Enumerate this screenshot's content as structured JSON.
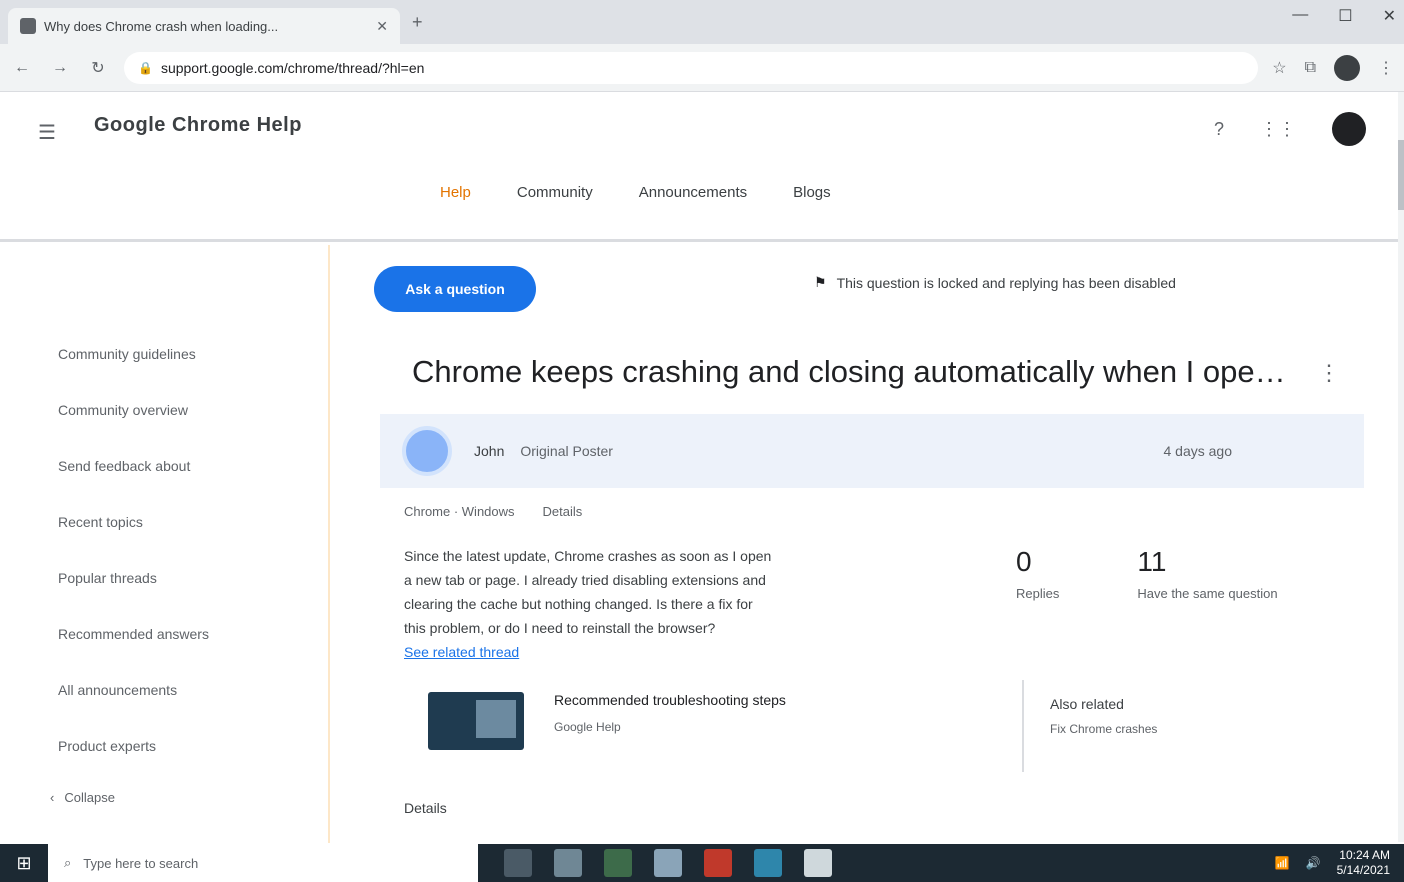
{
  "browser": {
    "tab_title": "Why does Chrome crash when loading...",
    "new_tab_symbol": "+",
    "window_controls": [
      "—",
      "☐",
      "✕"
    ],
    "url": "support.google.com/chrome/thread/?hl=en",
    "nav_symbols": [
      "←",
      "→",
      "↻"
    ],
    "toolbar_icons": [
      "star-icon",
      "extension-icon",
      "more-icon"
    ]
  },
  "site": {
    "logo": "Google Chrome Help",
    "nav_tabs": [
      "Help",
      "Community",
      "Announcements",
      "Blogs"
    ],
    "active_tab": 0,
    "header_icons": [
      "help-icon",
      "apps-icon",
      "account-avatar"
    ]
  },
  "sidebar": {
    "items": [
      "Community guidelines",
      "Community overview",
      "Send feedback about",
      "Recent topics",
      "Popular threads",
      "Recommended answers",
      "All announcements",
      "Product experts"
    ],
    "collapse_label": "Collapse"
  },
  "main": {
    "ask_button": "Ask a question",
    "notice_flag": "⚑",
    "notice": "This question is locked and replying has been disabled",
    "title": "Chrome keeps crashing and closing automatically when I open a new tab or page since update",
    "more_icon": "⋮",
    "author": {
      "name": "John",
      "role": "Original Poster",
      "time": "4 days ago"
    },
    "meta": [
      "Chrome · Windows",
      "Details"
    ],
    "body_lines": [
      "Since the latest update, Chrome crashes as soon as I open",
      "a new tab or page. I already tried disabling extensions and",
      "clearing the cache but nothing changed. Is there a fix for",
      "this problem, or do I need to reinstall the browser?"
    ],
    "body_link": "See related thread",
    "stats": [
      {
        "num": "0",
        "label": "Replies"
      },
      {
        "num": "11",
        "label": "Have the same question"
      }
    ],
    "card": {
      "title": "Recommended troubleshooting steps",
      "sub": "Google Help"
    },
    "side_card": {
      "title": "Also related",
      "sub": "Fix Chrome crashes"
    },
    "section_label": "Details"
  },
  "taskbar": {
    "start_symbol": "⊞",
    "search_placeholder": "Type here to search",
    "app_colors": [
      "#4a5a66",
      "#6f8795",
      "#3d6b4a",
      "#8aa4b8",
      "#c0392b",
      "#2e86ab",
      "#cfd8dc"
    ],
    "time": "10:24 AM",
    "date": "5/14/2021"
  }
}
